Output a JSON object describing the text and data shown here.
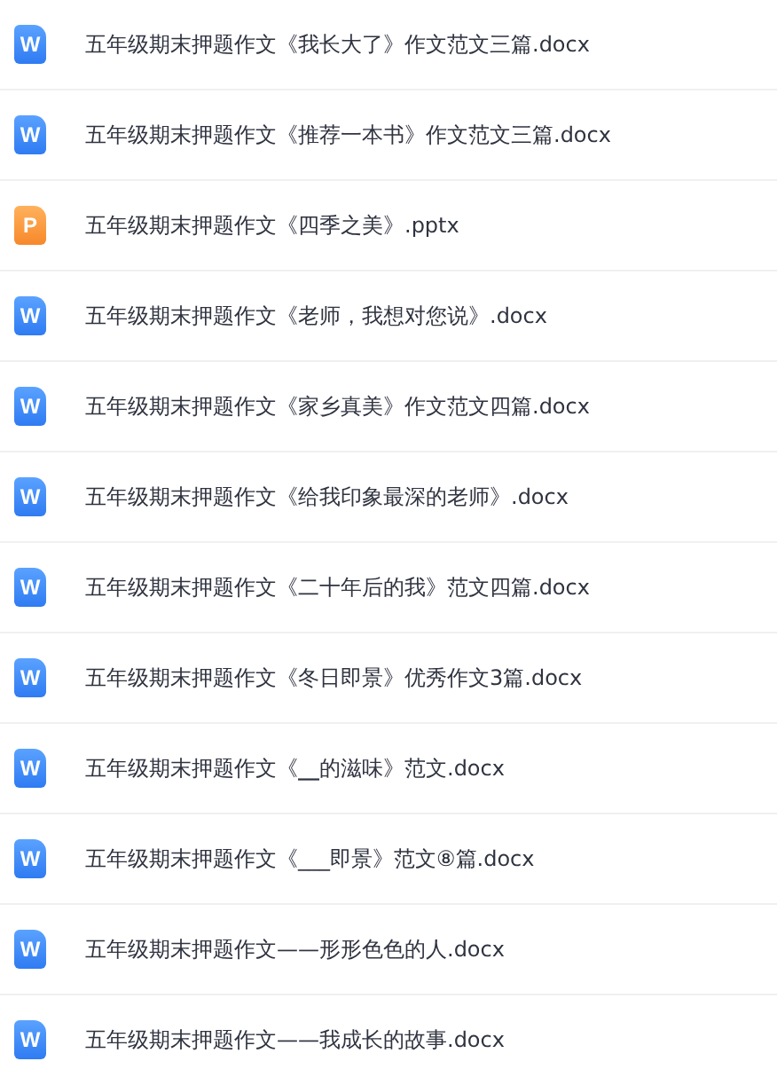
{
  "files": [
    {
      "kind": "word",
      "icon_letter": "W",
      "name": "五年级期末押题作文《我长大了》作文范文三篇.docx"
    },
    {
      "kind": "word",
      "icon_letter": "W",
      "name": "五年级期末押题作文《推荐一本书》作文范文三篇.docx"
    },
    {
      "kind": "ppt",
      "icon_letter": "P",
      "name": "五年级期末押题作文《四季之美》.pptx"
    },
    {
      "kind": "word",
      "icon_letter": "W",
      "name": "五年级期末押题作文《老师，我想对您说》.docx"
    },
    {
      "kind": "word",
      "icon_letter": "W",
      "name": "五年级期末押题作文《家乡真美》作文范文四篇.docx"
    },
    {
      "kind": "word",
      "icon_letter": "W",
      "name": "五年级期末押题作文《给我印象最深的老师》.docx"
    },
    {
      "kind": "word",
      "icon_letter": "W",
      "name": "五年级期末押题作文《二十年后的我》范文四篇.docx"
    },
    {
      "kind": "word",
      "icon_letter": "W",
      "name": "五年级期末押题作文《冬日即景》优秀作文3篇.docx"
    },
    {
      "kind": "word",
      "icon_letter": "W",
      "name": "五年级期末押题作文《**__**的滋味》范文.docx"
    },
    {
      "kind": "word",
      "icon_letter": "W",
      "name": "五年级期末押题作文《___即景》范文⑧篇.docx"
    },
    {
      "kind": "word",
      "icon_letter": "W",
      "name": "五年级期末押题作文——形形色色的人.docx"
    },
    {
      "kind": "word",
      "icon_letter": "W",
      "name": "五年级期末押题作文——我成长的故事.docx"
    }
  ]
}
